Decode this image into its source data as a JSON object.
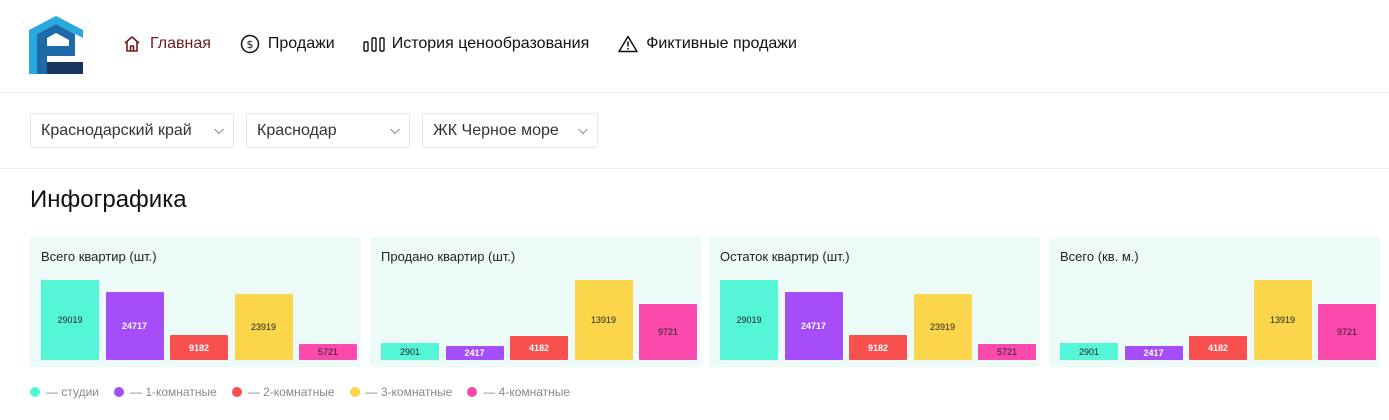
{
  "header": {
    "nav": [
      {
        "label": "Главная",
        "icon": "home-icon",
        "active": true
      },
      {
        "label": "Продажи",
        "icon": "dollar-circle-icon",
        "active": false
      },
      {
        "label": "История ценообразования",
        "icon": "columns-icon",
        "active": false
      },
      {
        "label": "Фиктивные продажи",
        "icon": "warning-triangle-icon",
        "active": false
      }
    ]
  },
  "filters": {
    "region": "Краснодарский край",
    "city": "Краснодар",
    "complex": "ЖК Черное море"
  },
  "page_title": "Инфографика",
  "colors": {
    "studio": "#55f5d8",
    "one_room": "#a64dfa",
    "two_room": "#f84f4f",
    "three_room": "#fcd64a",
    "four_room": "#fb49ad",
    "card_bg": "#ecfbf8",
    "active_nav": "#6e1b1b"
  },
  "chart_data": [
    {
      "type": "bar",
      "title": "Всего квартир (шт.)",
      "categories": [
        "студии",
        "1-комнатные",
        "2-комнатные",
        "3-комнатные",
        "4-комнатные"
      ],
      "values": [
        29019,
        24717,
        9182,
        23919,
        5721
      ],
      "labels": [
        "29019",
        "24717",
        "9182",
        "23919",
        "5721"
      ]
    },
    {
      "type": "bar",
      "title": "Продано квартир (шт.)",
      "categories": [
        "студии",
        "1-комнатные",
        "2-комнатные",
        "3-комнатные",
        "4-комнатные"
      ],
      "values": [
        2901,
        2417,
        4182,
        13919,
        9721
      ],
      "labels": [
        "2901",
        "2417",
        "4182",
        "13919",
        "9721"
      ]
    },
    {
      "type": "bar",
      "title": "Остаток квартир (шт.)",
      "categories": [
        "студии",
        "1-комнатные",
        "2-комнатные",
        "3-комнатные",
        "4-комнатные"
      ],
      "values": [
        29019,
        24717,
        9182,
        23919,
        5721
      ],
      "labels": [
        "29019",
        "24717",
        "9182",
        "23919",
        "5721"
      ]
    },
    {
      "type": "bar",
      "title": "Всего (кв. м.)",
      "categories": [
        "студии",
        "1-комнатные",
        "2-комнатные",
        "3-комнатные",
        "4-комнатные"
      ],
      "values": [
        2901,
        2417,
        4182,
        13919,
        9721
      ],
      "labels": [
        "2901",
        "2417",
        "4182",
        "13919",
        "9721"
      ]
    }
  ],
  "legend": [
    {
      "label": "— студии",
      "color": "#55f5d8"
    },
    {
      "label": "— 1-комнатные",
      "color": "#a64dfa"
    },
    {
      "label": "— 2-комнатные",
      "color": "#f84f4f"
    },
    {
      "label": "— 3-комнатные",
      "color": "#fcd64a"
    },
    {
      "label": "— 4-комнатные",
      "color": "#fb49ad"
    }
  ]
}
